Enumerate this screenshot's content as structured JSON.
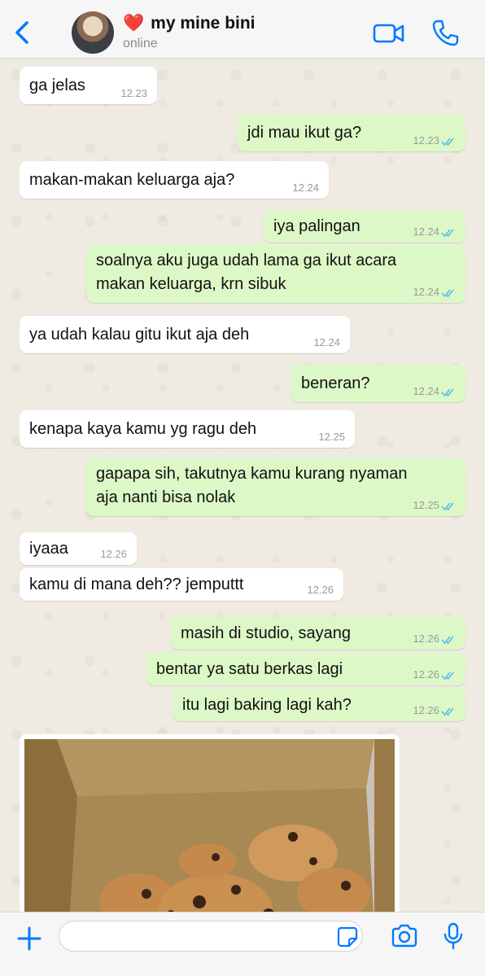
{
  "header": {
    "back_icon": "chevron-left-icon",
    "heart_emoji": "❤️",
    "contact_name": "my mine bini",
    "status": "online",
    "video_icon": "video-camera-icon",
    "call_icon": "phone-icon",
    "accent_color": "#007aff"
  },
  "messages": [
    {
      "dir": "in",
      "text": "ga jelas",
      "time": "12.23"
    },
    {
      "dir": "out",
      "text": "jdi mau ikut ga?",
      "time": "12.23",
      "read": true
    },
    {
      "dir": "in",
      "text": "makan-makan keluarga aja?",
      "time": "12.24"
    },
    {
      "dir": "out",
      "text": "iya palingan",
      "time": "12.24",
      "read": true
    },
    {
      "dir": "out",
      "text_lines": [
        "soalnya aku juga udah lama ga ikut acara",
        "makan keluarga, krn sibuk"
      ],
      "time": "12.24",
      "read": true
    },
    {
      "dir": "in",
      "text": "ya udah kalau gitu ikut aja deh",
      "time": "12.24"
    },
    {
      "dir": "out",
      "text": "beneran?",
      "time": "12.24",
      "read": true
    },
    {
      "dir": "in",
      "text": "kenapa kaya kamu yg ragu deh",
      "time": "12.25"
    },
    {
      "dir": "out",
      "text_lines": [
        "gapapa sih, takutnya kamu kurang nyaman",
        "aja nanti bisa nolak"
      ],
      "time": "12.25",
      "read": true
    },
    {
      "dir": "in",
      "text": "iyaaa",
      "time": "12.26"
    },
    {
      "dir": "in",
      "text": "kamu di mana deh?? jemputtt",
      "time": "12.26"
    },
    {
      "dir": "out",
      "text": "masih di studio, sayang",
      "time": "12.26",
      "read": true
    },
    {
      "dir": "out",
      "text": "bentar ya satu berkas lagi",
      "time": "12.26",
      "read": true
    },
    {
      "dir": "out",
      "text": "itu lagi baking lagi kah?",
      "time": "12.26",
      "read": true
    }
  ],
  "photo_message": {
    "dir": "in",
    "subject": "box of chocolate chip cookies"
  },
  "colors": {
    "incoming": "#ffffff",
    "outgoing": "#dcf8c6",
    "read_ticks": "#53bdeb",
    "background": "#efeae2"
  },
  "input": {
    "plus_icon": "plus-icon",
    "placeholder": "",
    "sticker_icon": "sticker-icon",
    "camera_icon": "camera-icon",
    "mic_icon": "microphone-icon"
  }
}
